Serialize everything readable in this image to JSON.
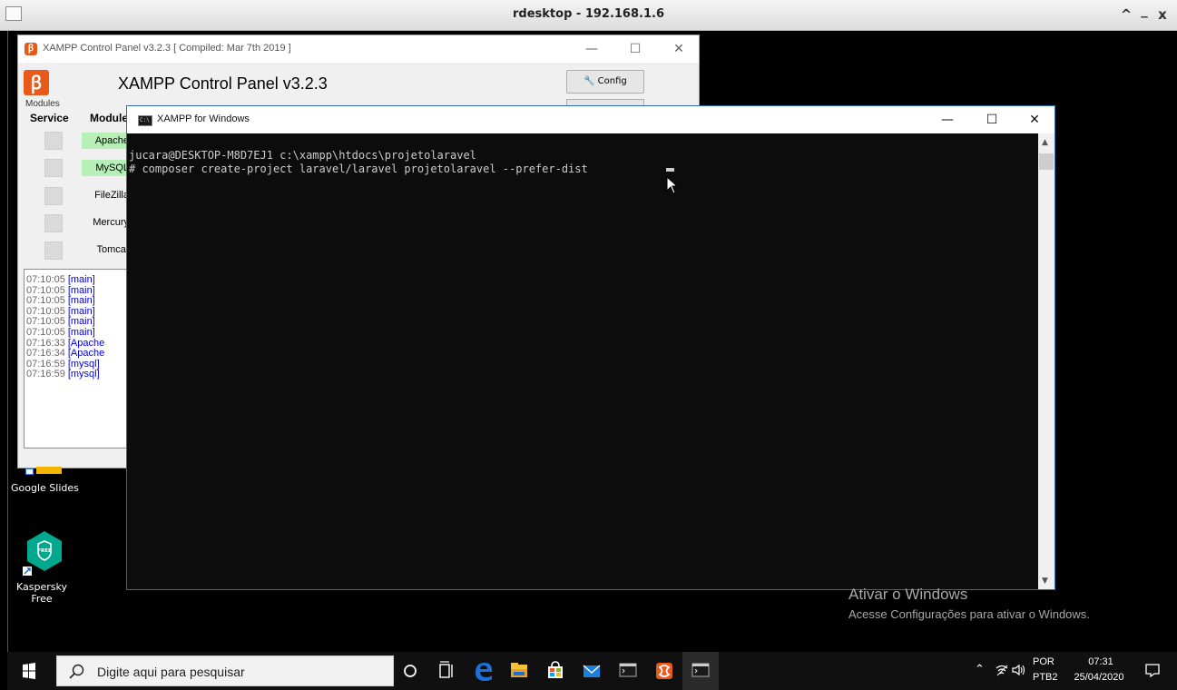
{
  "rdesktop": {
    "title": "rdesktop - 192.168.1.6",
    "ctrl_up": "^",
    "ctrl_min": "_",
    "ctrl_close": "x"
  },
  "xampp": {
    "window_title": "XAMPP Control Panel v3.2.3   [ Compiled: Mar 7th 2019 ]",
    "heading": "XAMPP Control Panel v3.2.3",
    "logo_text": "ꞵ",
    "config_label": "Config",
    "modules_label": "Modules",
    "col_service": "Service",
    "col_module": "Module",
    "modules": [
      "Apache",
      "MySQL",
      "FileZilla",
      "Mercury",
      "Tomcat"
    ],
    "log": [
      {
        "time": "07:10:05",
        "module": "[main]"
      },
      {
        "time": "07:10:05",
        "module": "[main]"
      },
      {
        "time": "07:10:05",
        "module": "[main]"
      },
      {
        "time": "07:10:05",
        "module": "[main]"
      },
      {
        "time": "07:10:05",
        "module": "[main]"
      },
      {
        "time": "07:10:05",
        "module": "[main]"
      },
      {
        "time": "07:16:33",
        "module": "[Apache"
      },
      {
        "time": "07:16:34",
        "module": "[Apache"
      },
      {
        "time": "07:16:59",
        "module": "[mysql]"
      },
      {
        "time": "07:16:59",
        "module": "[mysql]"
      }
    ]
  },
  "cmd": {
    "title": "XAMPP for Windows",
    "line1": "jucara@DESKTOP-M8D7EJ1 c:\\xampp\\htdocs\\projetolaravel",
    "line2": "# composer create-project laravel/laravel projetolaravel --prefer-dist"
  },
  "desktop": {
    "google_slides": "Google Slides",
    "kaspersky": "Kaspersky\nFree",
    "kaspersky_badge": "FREE"
  },
  "activation": {
    "title": "Ativar o Windows",
    "subtitle": "Acesse Configurações para ativar o Windows."
  },
  "taskbar": {
    "search_placeholder": "Digite aqui para pesquisar",
    "lang_line1": "POR",
    "lang_line2": "PTB2",
    "time": "07:31",
    "date": "25/04/2020"
  },
  "colors": {
    "xampp_orange": "#e8591c",
    "running_green": "#b6f0b6",
    "edge_blue": "#1e6fd9",
    "kaspersky_teal": "#00a88e"
  }
}
